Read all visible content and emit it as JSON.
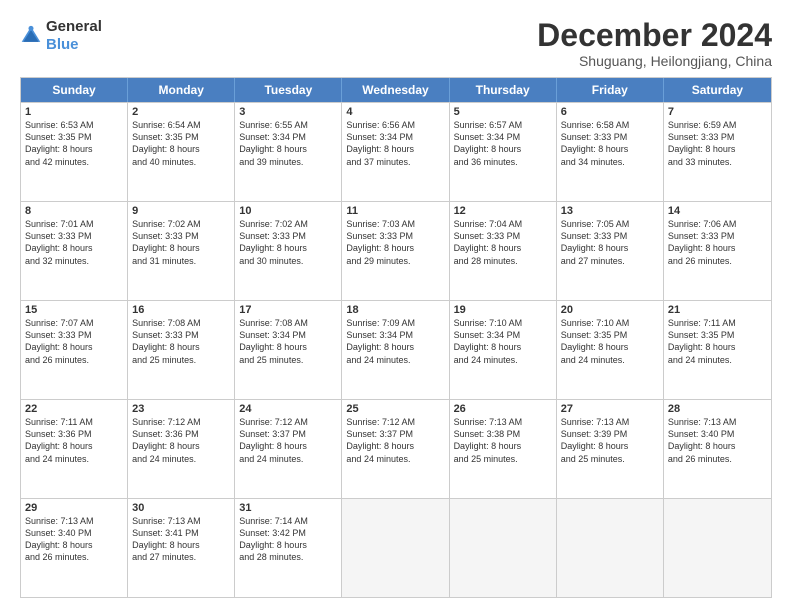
{
  "logo": {
    "general": "General",
    "blue": "Blue"
  },
  "title": "December 2024",
  "subtitle": "Shuguang, Heilongjiang, China",
  "header_days": [
    "Sunday",
    "Monday",
    "Tuesday",
    "Wednesday",
    "Thursday",
    "Friday",
    "Saturday"
  ],
  "weeks": [
    [
      {
        "day": "1",
        "lines": [
          "Sunrise: 6:53 AM",
          "Sunset: 3:35 PM",
          "Daylight: 8 hours",
          "and 42 minutes."
        ]
      },
      {
        "day": "2",
        "lines": [
          "Sunrise: 6:54 AM",
          "Sunset: 3:35 PM",
          "Daylight: 8 hours",
          "and 40 minutes."
        ]
      },
      {
        "day": "3",
        "lines": [
          "Sunrise: 6:55 AM",
          "Sunset: 3:34 PM",
          "Daylight: 8 hours",
          "and 39 minutes."
        ]
      },
      {
        "day": "4",
        "lines": [
          "Sunrise: 6:56 AM",
          "Sunset: 3:34 PM",
          "Daylight: 8 hours",
          "and 37 minutes."
        ]
      },
      {
        "day": "5",
        "lines": [
          "Sunrise: 6:57 AM",
          "Sunset: 3:34 PM",
          "Daylight: 8 hours",
          "and 36 minutes."
        ]
      },
      {
        "day": "6",
        "lines": [
          "Sunrise: 6:58 AM",
          "Sunset: 3:33 PM",
          "Daylight: 8 hours",
          "and 34 minutes."
        ]
      },
      {
        "day": "7",
        "lines": [
          "Sunrise: 6:59 AM",
          "Sunset: 3:33 PM",
          "Daylight: 8 hours",
          "and 33 minutes."
        ]
      }
    ],
    [
      {
        "day": "8",
        "lines": [
          "Sunrise: 7:01 AM",
          "Sunset: 3:33 PM",
          "Daylight: 8 hours",
          "and 32 minutes."
        ]
      },
      {
        "day": "9",
        "lines": [
          "Sunrise: 7:02 AM",
          "Sunset: 3:33 PM",
          "Daylight: 8 hours",
          "and 31 minutes."
        ]
      },
      {
        "day": "10",
        "lines": [
          "Sunrise: 7:02 AM",
          "Sunset: 3:33 PM",
          "Daylight: 8 hours",
          "and 30 minutes."
        ]
      },
      {
        "day": "11",
        "lines": [
          "Sunrise: 7:03 AM",
          "Sunset: 3:33 PM",
          "Daylight: 8 hours",
          "and 29 minutes."
        ]
      },
      {
        "day": "12",
        "lines": [
          "Sunrise: 7:04 AM",
          "Sunset: 3:33 PM",
          "Daylight: 8 hours",
          "and 28 minutes."
        ]
      },
      {
        "day": "13",
        "lines": [
          "Sunrise: 7:05 AM",
          "Sunset: 3:33 PM",
          "Daylight: 8 hours",
          "and 27 minutes."
        ]
      },
      {
        "day": "14",
        "lines": [
          "Sunrise: 7:06 AM",
          "Sunset: 3:33 PM",
          "Daylight: 8 hours",
          "and 26 minutes."
        ]
      }
    ],
    [
      {
        "day": "15",
        "lines": [
          "Sunrise: 7:07 AM",
          "Sunset: 3:33 PM",
          "Daylight: 8 hours",
          "and 26 minutes."
        ]
      },
      {
        "day": "16",
        "lines": [
          "Sunrise: 7:08 AM",
          "Sunset: 3:33 PM",
          "Daylight: 8 hours",
          "and 25 minutes."
        ]
      },
      {
        "day": "17",
        "lines": [
          "Sunrise: 7:08 AM",
          "Sunset: 3:34 PM",
          "Daylight: 8 hours",
          "and 25 minutes."
        ]
      },
      {
        "day": "18",
        "lines": [
          "Sunrise: 7:09 AM",
          "Sunset: 3:34 PM",
          "Daylight: 8 hours",
          "and 24 minutes."
        ]
      },
      {
        "day": "19",
        "lines": [
          "Sunrise: 7:10 AM",
          "Sunset: 3:34 PM",
          "Daylight: 8 hours",
          "and 24 minutes."
        ]
      },
      {
        "day": "20",
        "lines": [
          "Sunrise: 7:10 AM",
          "Sunset: 3:35 PM",
          "Daylight: 8 hours",
          "and 24 minutes."
        ]
      },
      {
        "day": "21",
        "lines": [
          "Sunrise: 7:11 AM",
          "Sunset: 3:35 PM",
          "Daylight: 8 hours",
          "and 24 minutes."
        ]
      }
    ],
    [
      {
        "day": "22",
        "lines": [
          "Sunrise: 7:11 AM",
          "Sunset: 3:36 PM",
          "Daylight: 8 hours",
          "and 24 minutes."
        ]
      },
      {
        "day": "23",
        "lines": [
          "Sunrise: 7:12 AM",
          "Sunset: 3:36 PM",
          "Daylight: 8 hours",
          "and 24 minutes."
        ]
      },
      {
        "day": "24",
        "lines": [
          "Sunrise: 7:12 AM",
          "Sunset: 3:37 PM",
          "Daylight: 8 hours",
          "and 24 minutes."
        ]
      },
      {
        "day": "25",
        "lines": [
          "Sunrise: 7:12 AM",
          "Sunset: 3:37 PM",
          "Daylight: 8 hours",
          "and 24 minutes."
        ]
      },
      {
        "day": "26",
        "lines": [
          "Sunrise: 7:13 AM",
          "Sunset: 3:38 PM",
          "Daylight: 8 hours",
          "and 25 minutes."
        ]
      },
      {
        "day": "27",
        "lines": [
          "Sunrise: 7:13 AM",
          "Sunset: 3:39 PM",
          "Daylight: 8 hours",
          "and 25 minutes."
        ]
      },
      {
        "day": "28",
        "lines": [
          "Sunrise: 7:13 AM",
          "Sunset: 3:40 PM",
          "Daylight: 8 hours",
          "and 26 minutes."
        ]
      }
    ],
    [
      {
        "day": "29",
        "lines": [
          "Sunrise: 7:13 AM",
          "Sunset: 3:40 PM",
          "Daylight: 8 hours",
          "and 26 minutes."
        ]
      },
      {
        "day": "30",
        "lines": [
          "Sunrise: 7:13 AM",
          "Sunset: 3:41 PM",
          "Daylight: 8 hours",
          "and 27 minutes."
        ]
      },
      {
        "day": "31",
        "lines": [
          "Sunrise: 7:14 AM",
          "Sunset: 3:42 PM",
          "Daylight: 8 hours",
          "and 28 minutes."
        ]
      },
      null,
      null,
      null,
      null
    ]
  ]
}
